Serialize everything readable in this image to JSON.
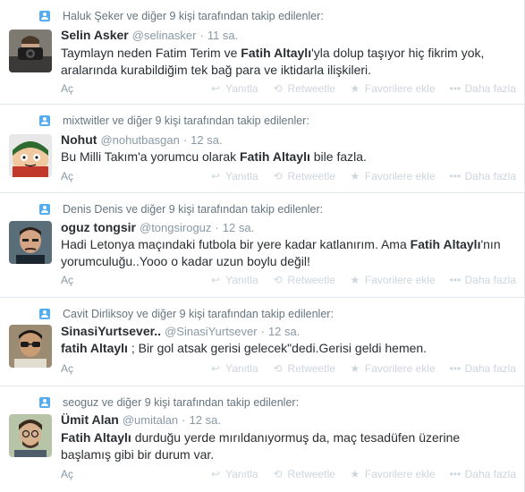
{
  "actions": {
    "reply": "Yanıtla",
    "retweet": "Retweetle",
    "favorite": "Favorilere ekle",
    "more": "Daha fazla",
    "open": "Aç"
  },
  "tweets": [
    {
      "context": "Haluk Şeker ve diğer 9 kişi tarafından takip edilenler:",
      "fullname": "Selin Asker",
      "username": "@selinasker",
      "time": "11 sa.",
      "segments": [
        {
          "t": "Taymlayn neden Fatim Terim ve ",
          "b": false
        },
        {
          "t": "Fatih Altaylı",
          "b": true
        },
        {
          "t": "'yla dolup taşıyor hiç fikrim yok, aralarında kurabildiğim tek bağ para ve iktidarla ilişkileri.",
          "b": false
        }
      ]
    },
    {
      "context": "mixtwitler ve diğer 9 kişi tarafından takip edilenler:",
      "fullname": "Nohut",
      "username": "@nohutbasgan",
      "time": "12 sa.",
      "segments": [
        {
          "t": "Bu Milli Takım'a yorumcu olarak ",
          "b": false
        },
        {
          "t": "Fatih Altaylı",
          "b": true
        },
        {
          "t": " bile fazla.",
          "b": false
        }
      ]
    },
    {
      "context": "Denis Denis ve diğer 9 kişi tarafından takip edilenler:",
      "fullname": "oguz tongsir",
      "username": "@tongsiroguz",
      "time": "12 sa.",
      "segments": [
        {
          "t": "Hadi Letonya maçındaki futbola bir yere kadar katlanırım. Ama ",
          "b": false
        },
        {
          "t": "Fatih Altaylı",
          "b": true
        },
        {
          "t": "'nın yorumculuğu..Yooo o kadar uzun boylu değil!",
          "b": false
        }
      ]
    },
    {
      "context": "Cavit Dirliksoy ve diğer 9 kişi tarafından takip edilenler:",
      "fullname": "SinasiYurtsever..",
      "username": "@SinasiYurtsever",
      "time": "12 sa.",
      "segments": [
        {
          "t": "fatih Altaylı",
          "b": true
        },
        {
          "t": " ; Bir gol atsak gerisi gelecek\"dedi.Gerisi geldi hemen.",
          "b": false
        }
      ]
    },
    {
      "context": "seoguz ve diğer 9 kişi tarafından takip edilenler:",
      "fullname": "Ümit Alan",
      "username": "@umitalan",
      "time": "12 sa.",
      "segments": [
        {
          "t": "Fatih Altaylı",
          "b": true
        },
        {
          "t": " durduğu yerde mırıldanıyormuş da, maç tesadüfen üzerine başlamış gibi bir durum var.",
          "b": false
        }
      ]
    }
  ]
}
